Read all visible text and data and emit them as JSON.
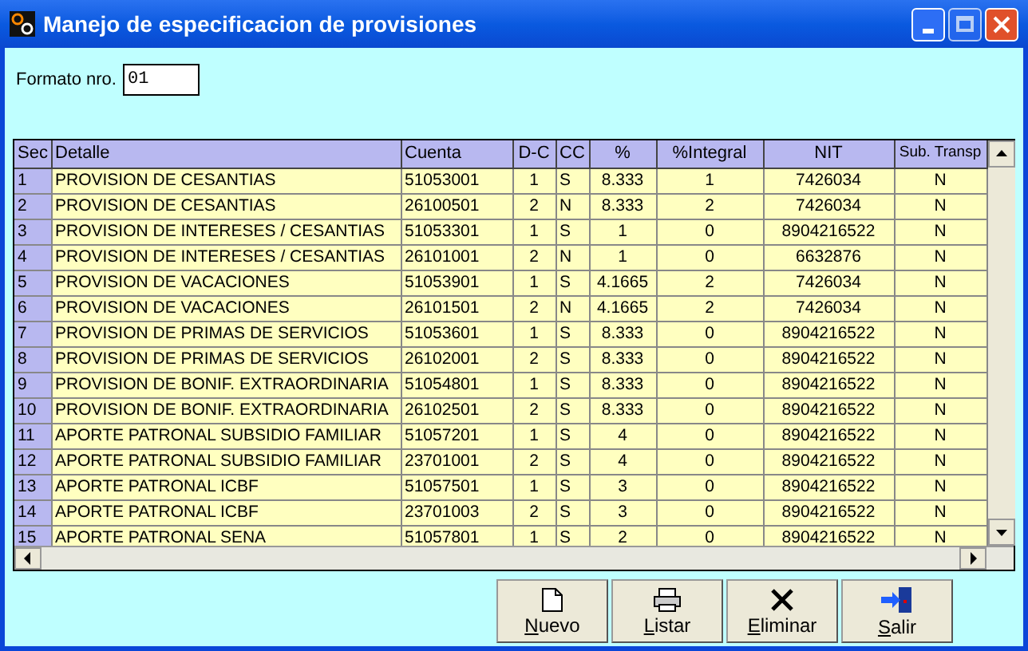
{
  "window": {
    "title": "Manejo de especificacion de provisiones"
  },
  "format": {
    "label": "Formato nro.",
    "value": "01"
  },
  "table": {
    "columns": [
      "Sec",
      "Detalle",
      "Cuenta",
      "D-C",
      "CC",
      "%",
      "%Integral",
      "NIT",
      "Sub. Transp"
    ],
    "rows": [
      [
        "1",
        "PROVISION DE CESANTIAS",
        "51053001",
        "1",
        "S",
        "8.333",
        "1",
        "7426034",
        "N"
      ],
      [
        "2",
        "PROVISION DE CESANTIAS",
        "26100501",
        "2",
        "N",
        "8.333",
        "2",
        "7426034",
        "N"
      ],
      [
        "3",
        "PROVISION DE INTERESES / CESANTIAS",
        "51053301",
        "1",
        "S",
        "1",
        "0",
        "8904216522",
        "N"
      ],
      [
        "4",
        "PROVISION DE INTERESES / CESANTIAS",
        "26101001",
        "2",
        "N",
        "1",
        "0",
        "6632876",
        "N"
      ],
      [
        "5",
        "PROVISION DE VACACIONES",
        "51053901",
        "1",
        "S",
        "4.1665",
        "2",
        "7426034",
        "N"
      ],
      [
        "6",
        "PROVISION DE VACACIONES",
        "26101501",
        "2",
        "N",
        "4.1665",
        "2",
        "7426034",
        "N"
      ],
      [
        "7",
        "PROVISION DE PRIMAS DE SERVICIOS",
        "51053601",
        "1",
        "S",
        "8.333",
        "0",
        "8904216522",
        "N"
      ],
      [
        "8",
        "PROVISION DE PRIMAS DE SERVICIOS",
        "26102001",
        "2",
        "S",
        "8.333",
        "0",
        "8904216522",
        "N"
      ],
      [
        "9",
        "PROVISION DE BONIF. EXTRAORDINARIA",
        "51054801",
        "1",
        "S",
        "8.333",
        "0",
        "8904216522",
        "N"
      ],
      [
        "10",
        "PROVISION DE BONIF. EXTRAORDINARIA",
        "26102501",
        "2",
        "S",
        "8.333",
        "0",
        "8904216522",
        "N"
      ],
      [
        "11",
        "APORTE PATRONAL SUBSIDIO FAMILIAR",
        "51057201",
        "1",
        "S",
        "4",
        "0",
        "8904216522",
        "N"
      ],
      [
        "12",
        "APORTE PATRONAL SUBSIDIO FAMILIAR",
        "23701001",
        "2",
        "S",
        "4",
        "0",
        "8904216522",
        "N"
      ],
      [
        "13",
        "APORTE PATRONAL ICBF",
        "51057501",
        "1",
        "S",
        "3",
        "0",
        "8904216522",
        "N"
      ],
      [
        "14",
        "APORTE PATRONAL ICBF",
        "23701003",
        "2",
        "S",
        "3",
        "0",
        "8904216522",
        "N"
      ],
      [
        "15",
        "APORTE PATRONAL SENA",
        "51057801",
        "1",
        "S",
        "2",
        "0",
        "8904216522",
        "N"
      ]
    ]
  },
  "buttons": [
    {
      "label": "Nuevo",
      "kind": "new"
    },
    {
      "label": "Listar",
      "kind": "print"
    },
    {
      "label": "Eliminar",
      "kind": "delete"
    },
    {
      "label": "Salir",
      "kind": "exit"
    }
  ]
}
